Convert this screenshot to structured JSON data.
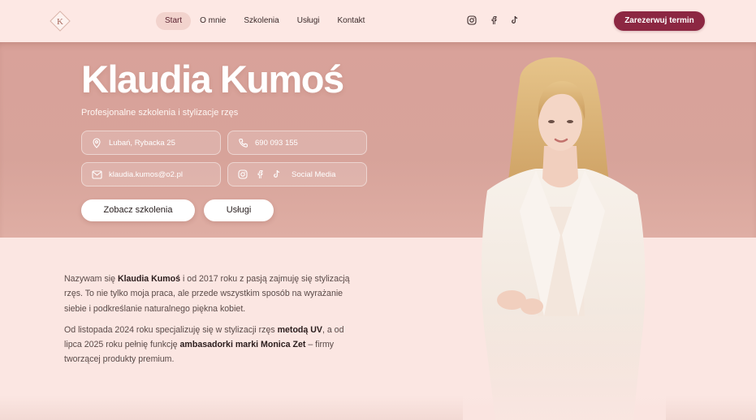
{
  "header": {
    "logo_letter": "K",
    "nav": [
      {
        "label": "Start",
        "active": true
      },
      {
        "label": "O mnie",
        "active": false
      },
      {
        "label": "Szkolenia",
        "active": false
      },
      {
        "label": "Usługi",
        "active": false
      },
      {
        "label": "Kontakt",
        "active": false
      }
    ],
    "socials": [
      "instagram-icon",
      "facebook-icon",
      "tiktok-icon"
    ],
    "cta_label": "Zarezerwuj termin"
  },
  "hero": {
    "title": "Klaudia Kumoś",
    "subtitle": "Profesjonalne szkolenia i stylizacje rzęs",
    "location": "Lubań, Rybacka 25",
    "phone": "690 093 155",
    "email": "klaudia.kumos@o2.pl",
    "social_label": "Social Media",
    "btn_primary": "Zobacz szkolenia",
    "btn_secondary": "Usługi"
  },
  "about": {
    "p1_before": "Nazywam się ",
    "p1_bold": "Klaudia Kumoś",
    "p1_after": " i od 2017 roku z pasją zajmuję się stylizacją rzęs. To nie tylko moja praca, ale przede wszystkim sposób na wyrażanie siebie i podkreślanie naturalnego piękna kobiet.",
    "p2_a": "Od listopada 2024 roku specjalizuję się w stylizacji rzęs ",
    "p2_bold1": "metodą UV",
    "p2_b": ", a od lipca 2025 roku pełnię funkcję ",
    "p2_bold2": "ambasadorki marki Monica Zet",
    "p2_c": " – firmy tworzącej produkty premium."
  },
  "colors": {
    "accent": "#8c2742",
    "hero_bg": "#d9a29a",
    "page_bg": "#fbe6e2",
    "nav_active_bg": "#f2d3cd"
  }
}
